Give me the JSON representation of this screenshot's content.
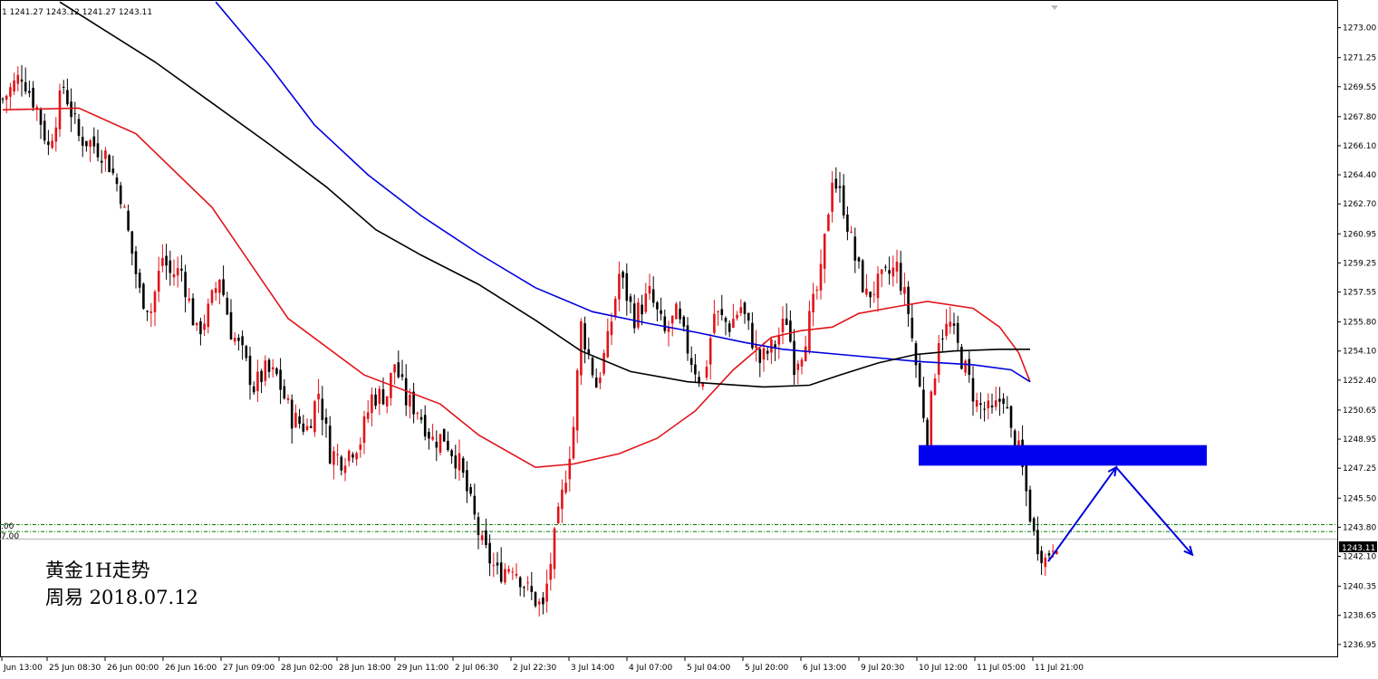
{
  "header": {
    "ohlc_text": "1  1241.27 1243.12 1241.27 1243.11"
  },
  "annotation": {
    "line1": "黄金1H走势",
    "line2": "周易  2018.07.12"
  },
  "price_badge": "1243.11",
  "left_level_labels": [
    ".00",
    "7.00"
  ],
  "colors": {
    "bull": "#e0141a",
    "bear": "#000000",
    "ma_red": "#e0141a",
    "ma_blue": "#0000dd",
    "ma_black": "#000000",
    "zone": "#0000ee",
    "arrow": "#0000dd",
    "level": "#008000",
    "grid": "#c8c8c8"
  },
  "chart_data": {
    "type": "candlestick",
    "symbol_timeframe": "XAUUSD H1",
    "ylim": [
      1236.2,
      1274.3
    ],
    "y_ticks": [
      "1273.00",
      "1271.25",
      "1269.55",
      "1267.80",
      "1266.10",
      "1264.40",
      "1262.70",
      "1260.95",
      "1259.25",
      "1257.55",
      "1255.80",
      "1254.10",
      "1252.40",
      "1250.65",
      "1248.95",
      "1247.25",
      "1245.50",
      "1243.80",
      "1242.10",
      "1240.35",
      "1238.65",
      "1236.95"
    ],
    "x_ticks": [
      "Jun 13:00",
      "25 Jun 08:30",
      "26 Jun 00:00",
      "26 Jun 16:00",
      "27 Jun 09:00",
      "28 Jun 02:00",
      "28 Jun 18:00",
      "29 Jun 11:00",
      "2 Jul 06:30",
      "2 Jul 22:30",
      "3 Jul 14:00",
      "4 Jul 07:00",
      "5 Jul 04:00",
      "5 Jul 20:00",
      "6 Jul 13:00",
      "9 Jul 20:30",
      "10 Jul 12:00",
      "11 Jul 05:00",
      "11 Jul 21:00"
    ],
    "close_path": [
      [
        0,
        1268.8
      ],
      [
        5,
        1270.3
      ],
      [
        9,
        1268.3
      ],
      [
        12,
        1266.0
      ],
      [
        16,
        1269.6
      ],
      [
        20,
        1266.6
      ],
      [
        23,
        1266.3
      ],
      [
        27,
        1265.6
      ],
      [
        31,
        1263.3
      ],
      [
        36,
        1257.5
      ],
      [
        39,
        1256.5
      ],
      [
        42,
        1259.6
      ],
      [
        44,
        1258.6
      ],
      [
        47,
        1258.8
      ],
      [
        51,
        1255.1
      ],
      [
        54,
        1256.4
      ],
      [
        57,
        1258.5
      ],
      [
        60,
        1255.3
      ],
      [
        63,
        1253.9
      ],
      [
        66,
        1252.0
      ],
      [
        69,
        1252.9
      ],
      [
        72,
        1252.6
      ],
      [
        76,
        1250.2
      ],
      [
        80,
        1249.6
      ],
      [
        83,
        1251.7
      ],
      [
        86,
        1248.2
      ],
      [
        89,
        1247.8
      ],
      [
        94,
        1248.9
      ],
      [
        97,
        1251.4
      ],
      [
        101,
        1251.6
      ],
      [
        103,
        1253.4
      ],
      [
        106,
        1251.2
      ],
      [
        109,
        1250.7
      ],
      [
        113,
        1248.9
      ],
      [
        116,
        1249.1
      ],
      [
        120,
        1247.5
      ],
      [
        126,
        1242.7
      ],
      [
        130,
        1241.1
      ],
      [
        134,
        1241.7
      ],
      [
        138,
        1240.1
      ],
      [
        142,
        1239.0
      ],
      [
        144,
        1241.8
      ],
      [
        147,
        1245.6
      ],
      [
        150,
        1249.7
      ],
      [
        152,
        1255.6
      ],
      [
        156,
        1252.1
      ],
      [
        159,
        1254.6
      ],
      [
        162,
        1258.6
      ],
      [
        166,
        1256.1
      ],
      [
        170,
        1257.4
      ],
      [
        174,
        1255.1
      ],
      [
        177,
        1256.2
      ],
      [
        181,
        1253.6
      ],
      [
        184,
        1252.1
      ],
      [
        187,
        1256.3
      ],
      [
        191,
        1255.6
      ],
      [
        194,
        1256.7
      ],
      [
        199,
        1253.5
      ],
      [
        203,
        1254.5
      ],
      [
        206,
        1256.0
      ],
      [
        208,
        1253.4
      ],
      [
        210,
        1254.2
      ],
      [
        212,
        1255.9
      ],
      [
        215,
        1258.5
      ],
      [
        218,
        1264.4
      ],
      [
        221,
        1262.6
      ],
      [
        224,
        1259.5
      ],
      [
        227,
        1257.3
      ],
      [
        231,
        1258.2
      ],
      [
        235,
        1259.0
      ],
      [
        238,
        1256.4
      ],
      [
        240,
        1253.3
      ],
      [
        243,
        1249.1
      ],
      [
        246,
        1255.0
      ],
      [
        249,
        1255.6
      ],
      [
        253,
        1253.0
      ],
      [
        256,
        1251.0
      ],
      [
        260,
        1250.4
      ],
      [
        263,
        1251.6
      ],
      [
        265,
        1249.2
      ],
      [
        267,
        1248.2
      ],
      [
        268,
        1247.1
      ],
      [
        271,
        1243.3
      ],
      [
        274,
        1241.9
      ],
      [
        276,
        1242.9
      ],
      [
        277,
        1243.1
      ]
    ],
    "moving_averages": [
      {
        "color": "red",
        "points": [
          [
            0,
            1268.2
          ],
          [
            20,
            1268.3
          ],
          [
            35,
            1266.8
          ],
          [
            55,
            1262.5
          ],
          [
            75,
            1256.0
          ],
          [
            95,
            1252.7
          ],
          [
            115,
            1251.0
          ],
          [
            125,
            1249.2
          ],
          [
            140,
            1247.3
          ],
          [
            150,
            1247.5
          ],
          [
            162,
            1248.1
          ],
          [
            172,
            1249.0
          ],
          [
            182,
            1250.6
          ],
          [
            192,
            1253.0
          ],
          [
            202,
            1254.9
          ],
          [
            210,
            1255.3
          ],
          [
            218,
            1255.5
          ],
          [
            225,
            1256.3
          ],
          [
            235,
            1256.7
          ],
          [
            243,
            1257.0
          ],
          [
            255,
            1256.6
          ],
          [
            262,
            1255.5
          ],
          [
            267,
            1254.0
          ],
          [
            270,
            1252.3
          ]
        ]
      },
      {
        "color": "blue",
        "points": [
          [
            56,
            1274.5
          ],
          [
            70,
            1270.8
          ],
          [
            82,
            1267.3
          ],
          [
            96,
            1264.4
          ],
          [
            110,
            1262.0
          ],
          [
            125,
            1259.8
          ],
          [
            140,
            1257.8
          ],
          [
            155,
            1256.4
          ],
          [
            170,
            1255.7
          ],
          [
            182,
            1255.2
          ],
          [
            195,
            1254.6
          ],
          [
            205,
            1254.2
          ],
          [
            220,
            1253.9
          ],
          [
            240,
            1253.5
          ],
          [
            255,
            1253.3
          ],
          [
            265,
            1253.0
          ],
          [
            270,
            1252.3
          ]
        ]
      },
      {
        "color": "black",
        "points": [
          [
            15,
            1274.5
          ],
          [
            25,
            1273.1
          ],
          [
            40,
            1271.0
          ],
          [
            55,
            1268.6
          ],
          [
            70,
            1266.2
          ],
          [
            85,
            1263.7
          ],
          [
            98,
            1261.2
          ],
          [
            110,
            1259.7
          ],
          [
            125,
            1258.0
          ],
          [
            140,
            1255.9
          ],
          [
            152,
            1254.1
          ],
          [
            165,
            1252.9
          ],
          [
            180,
            1252.3
          ],
          [
            200,
            1252.0
          ],
          [
            212,
            1252.1
          ],
          [
            220,
            1252.7
          ],
          [
            230,
            1253.4
          ],
          [
            240,
            1253.9
          ],
          [
            250,
            1254.1
          ],
          [
            262,
            1254.2
          ],
          [
            270,
            1254.2
          ]
        ]
      }
    ],
    "resistance_zone": [
      1247.4,
      1248.6
    ],
    "levels": [
      1243.95,
      1243.55,
      1243.11
    ],
    "projection_path": [
      [
        1241.8
      ],
      [
        1247.3
      ],
      [
        1242.2
      ]
    ]
  }
}
